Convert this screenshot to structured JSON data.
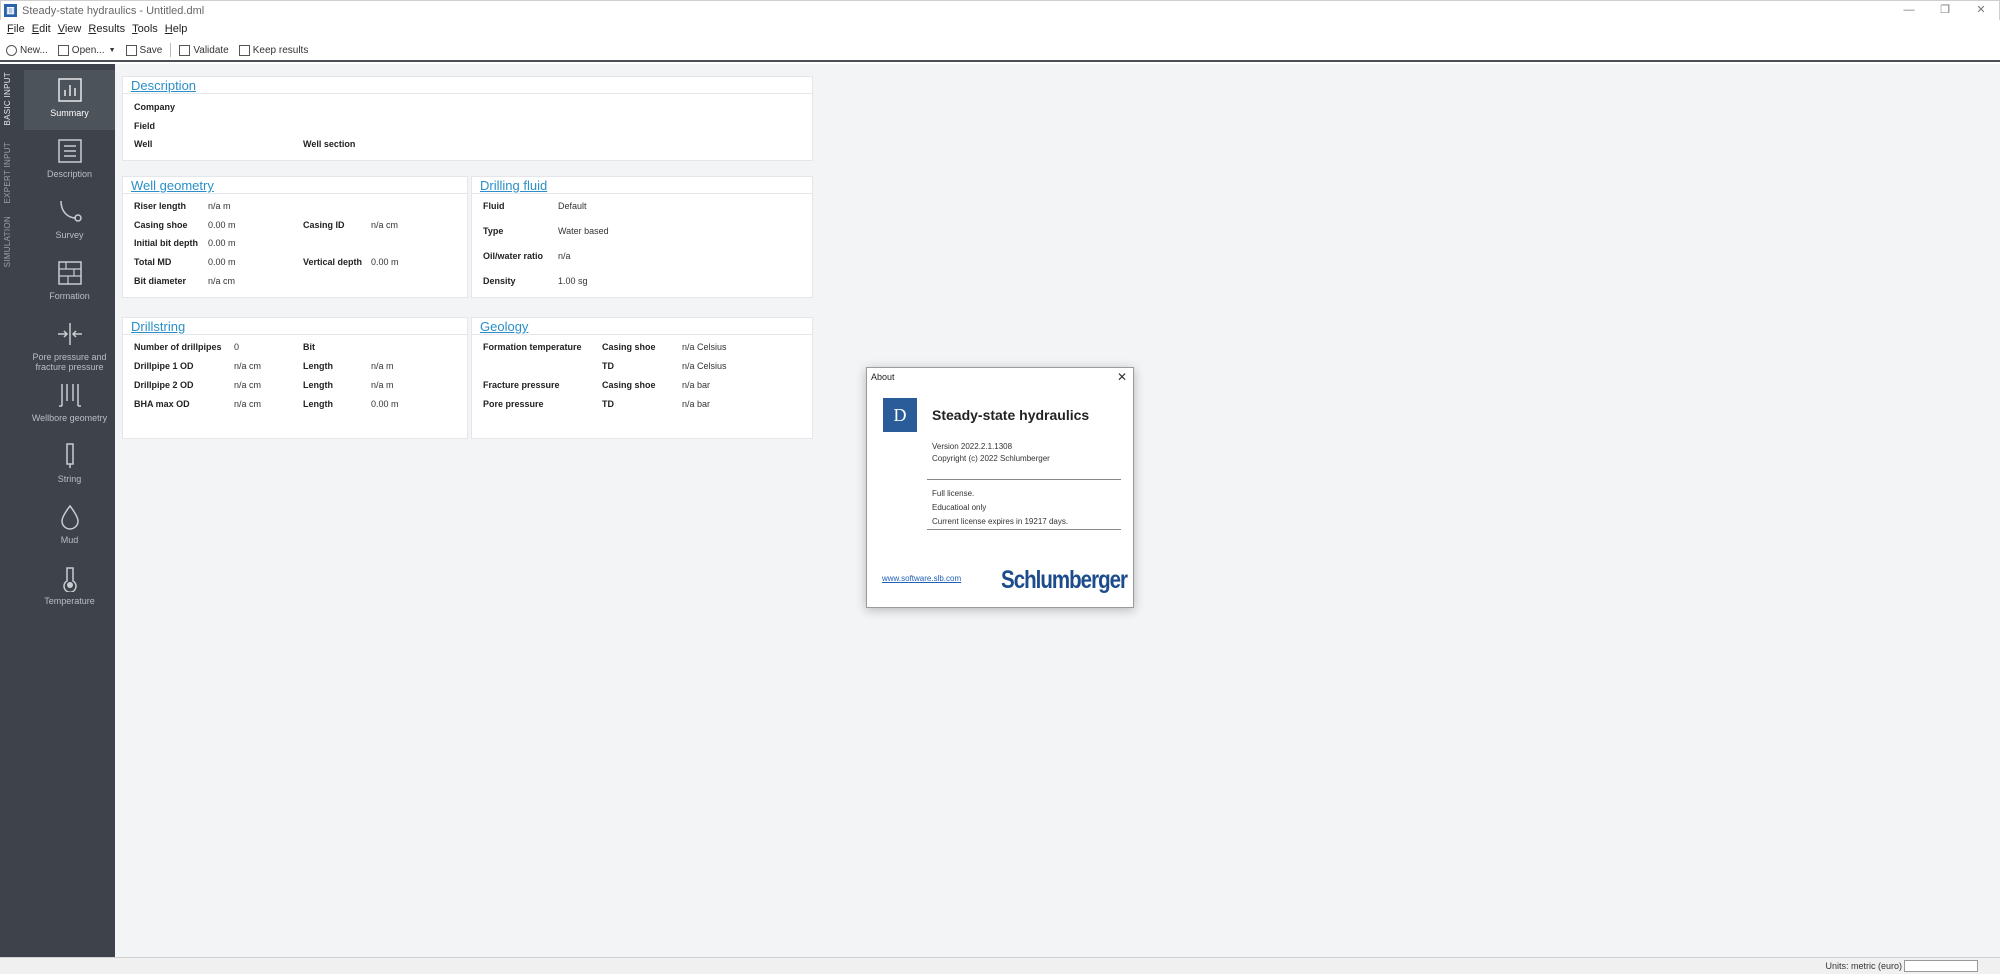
{
  "window": {
    "title": "Steady-state hydraulics - Untitled.dml",
    "icon": "app-logo-icon"
  },
  "menu": [
    {
      "label": "File",
      "u": "F",
      "rest": "ile"
    },
    {
      "label": "Edit",
      "u": "E",
      "rest": "dit"
    },
    {
      "label": "View",
      "u": "V",
      "rest": "iew"
    },
    {
      "label": "Results",
      "u": "R",
      "rest": "esults"
    },
    {
      "label": "Tools",
      "u": "T",
      "rest": "ools"
    },
    {
      "label": "Help",
      "u": "H",
      "rest": "elp"
    }
  ],
  "toolbar": {
    "new_label": "New...",
    "open_label": "Open...",
    "save_label": "Save",
    "validate_label": "Validate",
    "keep_label": "Keep results"
  },
  "vtabs": {
    "basic": "BASIC INPUT",
    "expert": "EXPERT INPUT",
    "simulation": "SIMULATION"
  },
  "sidebar": [
    {
      "label": "Summary"
    },
    {
      "label": "Description"
    },
    {
      "label": "Survey"
    },
    {
      "label": "Formation"
    },
    {
      "label": "Pore pressure and fracture pressure"
    },
    {
      "label": "Wellbore geometry"
    },
    {
      "label": "String"
    },
    {
      "label": "Mud"
    },
    {
      "label": "Temperature"
    }
  ],
  "description": {
    "title": "Description",
    "company": "Company",
    "field": "Field",
    "well": "Well",
    "well_section": "Well section"
  },
  "well_geometry": {
    "title": "Well geometry",
    "riser_length": "Riser length",
    "riser_length_val": "n/a m",
    "casing_shoe": "Casing shoe",
    "casing_shoe_val": "0.00 m",
    "casing_id": "Casing ID",
    "casing_id_val": "n/a cm",
    "initial_bit_depth": "Initial bit depth",
    "initial_bit_depth_val": "0.00 m",
    "total_md": "Total MD",
    "total_md_val": "0.00 m",
    "vertical_depth": "Vertical depth",
    "vertical_depth_val": "0.00 m",
    "bit_diameter": "Bit diameter",
    "bit_diameter_val": "n/a cm"
  },
  "drilling_fluid": {
    "title": "Drilling fluid",
    "fluid": "Fluid",
    "fluid_val": "Default",
    "type": "Type",
    "type_val": "Water based",
    "oil_water": "Oil/water ratio",
    "oil_water_val": "n/a",
    "density": "Density",
    "density_val": "1.00 sg"
  },
  "drillstring": {
    "title": "Drillstring",
    "num_pipes": "Number of drillpipes",
    "num_pipes_val": "0",
    "bit": "Bit",
    "dp1": "Drillpipe 1 OD",
    "dp1_val": "n/a cm",
    "dp1_len": "Length",
    "dp1_len_val": "n/a m",
    "dp2": "Drillpipe 2 OD",
    "dp2_val": "n/a cm",
    "dp2_len": "Length",
    "dp2_len_val": "n/a m",
    "bha": "BHA max OD",
    "bha_val": "n/a cm",
    "bha_len": "Length",
    "bha_len_val": "0.00 m"
  },
  "geology": {
    "title": "Geology",
    "formation_temp": "Formation temperature",
    "casing_shoe_1": "Casing shoe",
    "casing_shoe_1_val": "n/a Celsius",
    "td_1": "TD",
    "td_1_val": "n/a Celsius",
    "fracture_pressure": "Fracture pressure",
    "casing_shoe_2": "Casing shoe",
    "casing_shoe_2_val": "n/a bar",
    "pore_pressure": "Pore pressure",
    "td_2": "TD",
    "td_2_val": "n/a bar"
  },
  "about": {
    "title": "About",
    "product": "Steady-state hydraulics",
    "version": "Version 2022.2.1.1308",
    "copyright": "Copyright (c) 2022 Schlumberger",
    "license1": "Full license.",
    "license2": "Educatioal only",
    "license3": "Current license expires in 19217 days.",
    "link": "www.software.slb.com",
    "brand": "Schlumberger"
  },
  "status": {
    "units": "Units: metric (euro)"
  },
  "colors": {
    "sidebar": "#3e434b",
    "accent": "#2a8fc8",
    "brand": "#1d4c8d"
  }
}
